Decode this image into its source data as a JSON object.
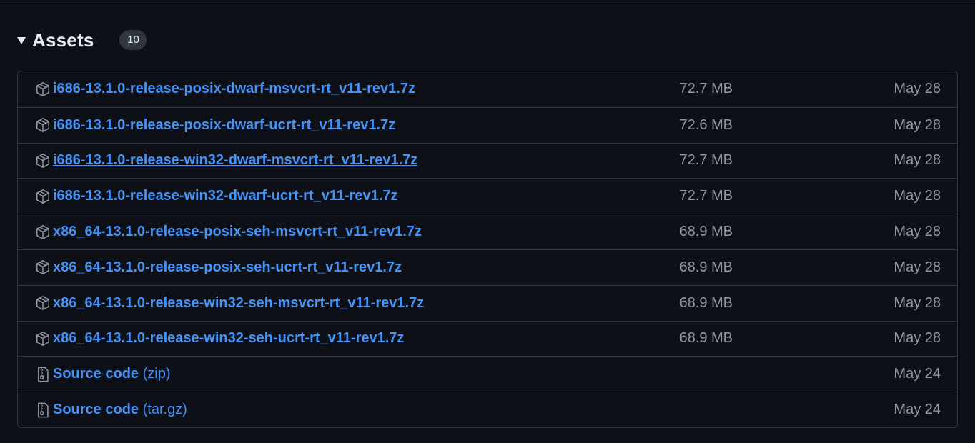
{
  "assets": {
    "title": "Assets",
    "count": "10",
    "items": [
      {
        "name": "i686-13.1.0-release-posix-dwarf-msvcrt-rt_v11-rev1.7z",
        "size": "72.7 MB",
        "date": "May 28",
        "icon": "package-icon"
      },
      {
        "name": "i686-13.1.0-release-posix-dwarf-ucrt-rt_v11-rev1.7z",
        "size": "72.6 MB",
        "date": "May 28",
        "icon": "package-icon"
      },
      {
        "name": "i686-13.1.0-release-win32-dwarf-msvcrt-rt_v11-rev1.7z",
        "size": "72.7 MB",
        "date": "May 28",
        "icon": "package-icon",
        "hovered": true
      },
      {
        "name": "i686-13.1.0-release-win32-dwarf-ucrt-rt_v11-rev1.7z",
        "size": "72.7 MB",
        "date": "May 28",
        "icon": "package-icon"
      },
      {
        "name": "x86_64-13.1.0-release-posix-seh-msvcrt-rt_v11-rev1.7z",
        "size": "68.9 MB",
        "date": "May 28",
        "icon": "package-icon"
      },
      {
        "name": "x86_64-13.1.0-release-posix-seh-ucrt-rt_v11-rev1.7z",
        "size": "68.9 MB",
        "date": "May 28",
        "icon": "package-icon"
      },
      {
        "name": "x86_64-13.1.0-release-win32-seh-msvcrt-rt_v11-rev1.7z",
        "size": "68.9 MB",
        "date": "May 28",
        "icon": "package-icon"
      },
      {
        "name": "x86_64-13.1.0-release-win32-seh-ucrt-rt_v11-rev1.7z",
        "size": "68.9 MB",
        "date": "May 28",
        "icon": "package-icon"
      },
      {
        "name": "Source code",
        "suffix": "(zip)",
        "size": "",
        "date": "May 24",
        "icon": "file-zip-icon"
      },
      {
        "name": "Source code",
        "suffix": "(tar.gz)",
        "size": "",
        "date": "May 24",
        "icon": "file-zip-icon"
      }
    ]
  },
  "colors": {
    "background": "#0d1117",
    "border": "#30363d",
    "link": "#4493f8",
    "muted": "#9198a1",
    "text": "#e6edf3"
  }
}
